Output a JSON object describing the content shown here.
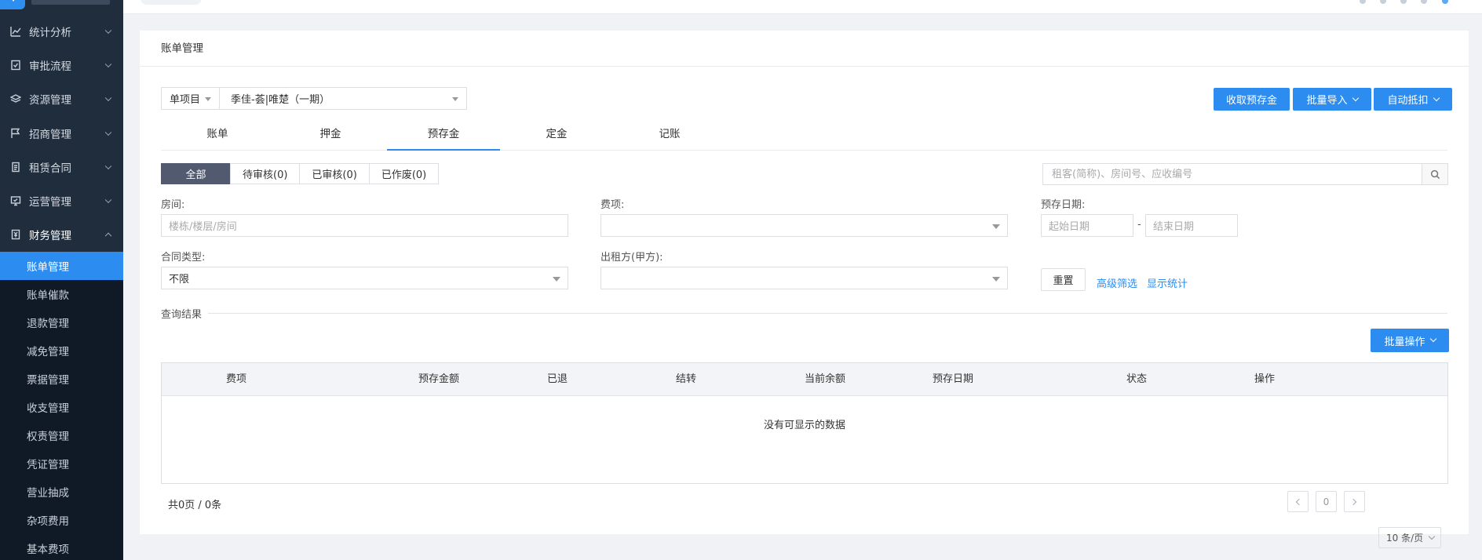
{
  "sidebar": {
    "groups": [
      {
        "label": "统计分析",
        "icon": "chart-icon"
      },
      {
        "label": "审批流程",
        "icon": "checklist-icon"
      },
      {
        "label": "资源管理",
        "icon": "layers-icon"
      },
      {
        "label": "招商管理",
        "icon": "flag-icon"
      },
      {
        "label": "租赁合同",
        "icon": "contract-icon"
      },
      {
        "label": "运营管理",
        "icon": "monitor-icon"
      },
      {
        "label": "财务管理",
        "icon": "finance-icon"
      }
    ],
    "finance_items": [
      "账单管理",
      "账单催款",
      "退款管理",
      "减免管理",
      "票据管理",
      "收支管理",
      "权责管理",
      "凭证管理",
      "营业抽成",
      "杂项费用",
      "基本费项"
    ]
  },
  "panel": {
    "title": "账单管理",
    "scope_select": "单项目",
    "project_select": "季佳-荟|唯楚（一期）",
    "buttons": {
      "collect": "收取预存金",
      "batch_import": "批量导入",
      "auto_deduct": "自动抵扣",
      "batch_ops": "批量操作"
    },
    "tabs": [
      "账单",
      "押金",
      "预存金",
      "定金",
      "记账"
    ],
    "active_tab": 2,
    "status_filters": [
      "全部",
      "待审核(0)",
      "已审核(0)",
      "已作废(0)"
    ],
    "search_placeholder": "租客(简称)、房间号、应收编号",
    "filters": {
      "room_label": "房间:",
      "room_placeholder": "楼栋/楼层/房间",
      "fee_label": "费项:",
      "date_label": "预存日期:",
      "date_start": "起始日期",
      "date_sep": "-",
      "date_end": "结束日期",
      "contract_label": "合同类型:",
      "contract_value": "不限",
      "lessor_label": "出租方(甲方):",
      "reset": "重置",
      "advanced": "高级筛选",
      "show_stats": "显示统计"
    },
    "result_label": "查询结果",
    "table": {
      "columns": [
        "费项",
        "预存金额",
        "已退",
        "结转",
        "当前余额",
        "预存日期",
        "状态",
        "操作"
      ],
      "empty": "没有可显示的数据"
    },
    "pagination": {
      "summary": "共0页 / 0条",
      "page": "0",
      "page_size": "10 条/页"
    }
  }
}
